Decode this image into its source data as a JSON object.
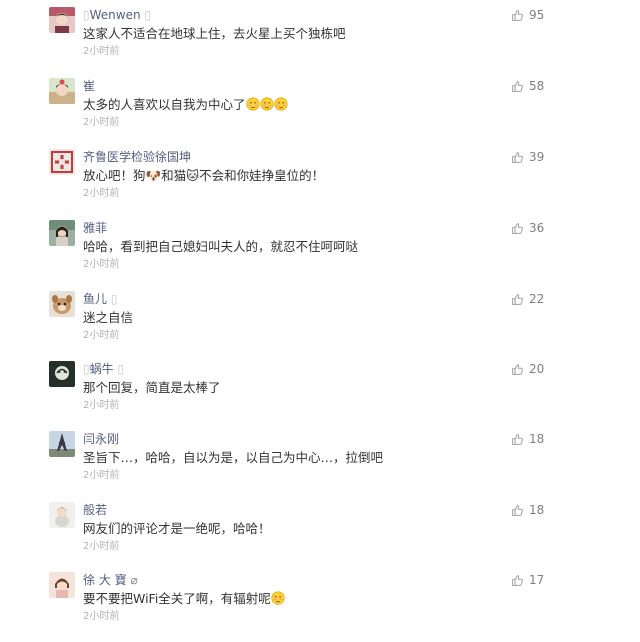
{
  "comments": [
    {
      "prefix": "",
      "name": "Wenwen",
      "suffix": "",
      "text": "这家人不适合在地球上住，去火星上买个独栋吧",
      "time": "2小时前",
      "likes": "95"
    },
    {
      "prefix": "",
      "name": "崔",
      "suffix": "",
      "text": "太多的人喜欢以自我为中心了",
      "time": "2小时前",
      "likes": "58"
    },
    {
      "prefix": "",
      "name": "齐鲁医学检验徐国坤",
      "suffix": "",
      "text_a": "放心吧！狗",
      "text_b": "和猫",
      "text_c": "不会和你娃挣皇位的！",
      "time": "2小时前",
      "likes": "39"
    },
    {
      "prefix": "",
      "name": "雅菲",
      "suffix": "",
      "text": "哈哈，看到把自己媳妇叫夫人的，就忍不住呵呵哒",
      "time": "2小时前",
      "likes": "36"
    },
    {
      "prefix": "",
      "name": "鱼儿",
      "suffix": "",
      "text": "迷之自信",
      "time": "2小时前",
      "likes": "22"
    },
    {
      "prefix": "",
      "name": "蜗牛",
      "suffix": "",
      "text": "那个回复，简直是太棒了",
      "time": "2小时前",
      "likes": "20"
    },
    {
      "prefix": "",
      "name": "闫永刚",
      "suffix": "",
      "text": "圣旨下…，哈哈，自以为是，以自己为中心…，拉倒吧",
      "time": "2小时前",
      "likes": "18"
    },
    {
      "prefix": "",
      "name": "般若",
      "suffix": "",
      "text": "网友们的评论才是一绝呢，哈哈！",
      "time": "2小时前",
      "likes": "18"
    },
    {
      "prefix": "",
      "name": "徐 大 寶",
      "suffix": "",
      "text": "要不要把WiFi全关了啊，有辐射呢",
      "time": "2小时前",
      "likes": "17"
    }
  ],
  "colors": {
    "name": "#556080",
    "text": "#333333",
    "time": "#b2b2b2",
    "like_count": "#808080",
    "like_icon": "#a0a0a0"
  },
  "icons": {
    "like": "thumbs-up-icon"
  }
}
